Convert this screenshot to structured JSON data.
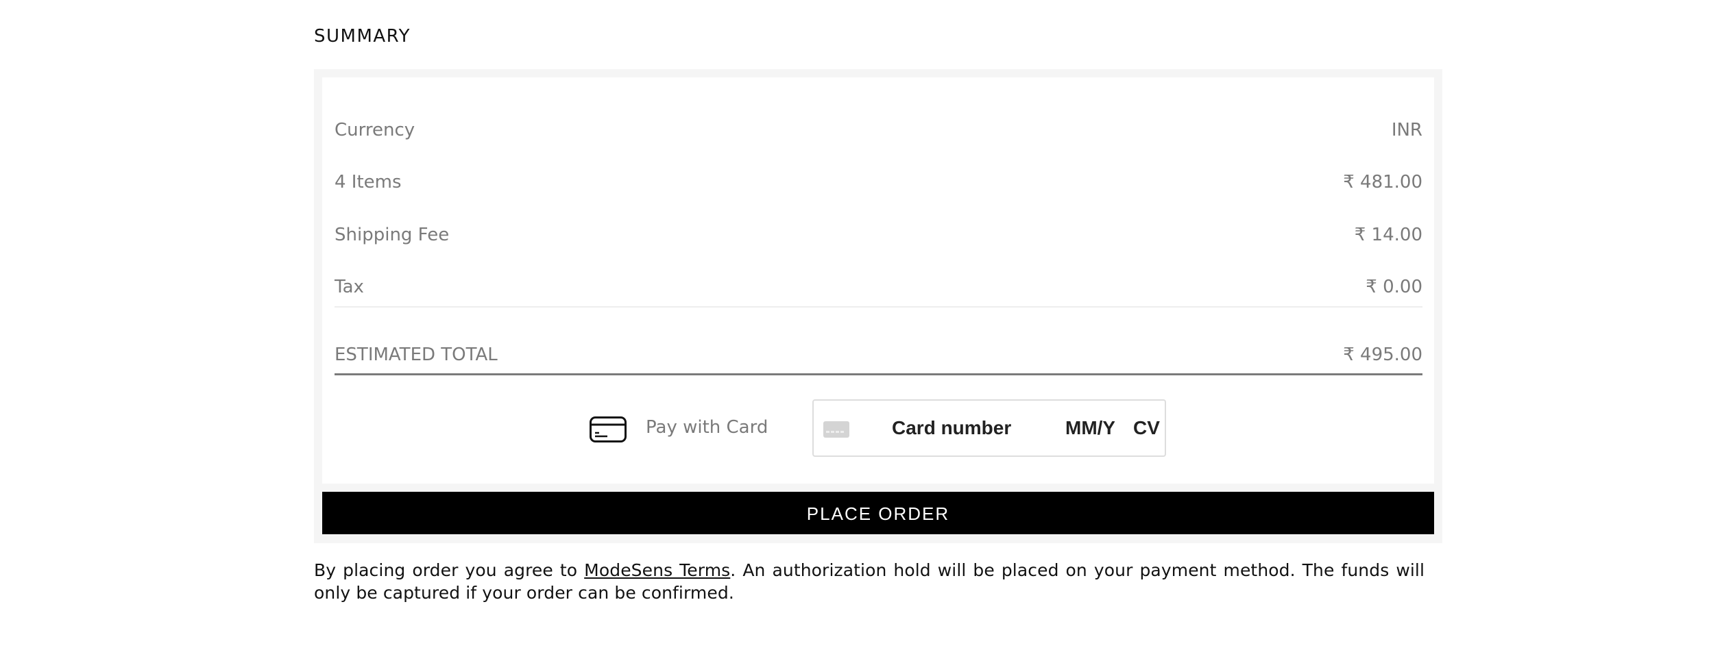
{
  "summary": {
    "title": "SUMMARY",
    "rows": [
      {
        "label": "Currency",
        "value": "INR"
      },
      {
        "label": "4 Items",
        "value": "₹ 481.00"
      },
      {
        "label": "Shipping Fee",
        "value": "₹ 14.00"
      },
      {
        "label": "Tax",
        "value": "₹ 0.00"
      }
    ],
    "total": {
      "label": "ESTIMATED TOTAL",
      "value": "₹ 495.00"
    }
  },
  "payment": {
    "pay_with_card_label": "Pay with Card",
    "card_number_placeholder": "Card number",
    "expiry_placeholder": "MM/YY",
    "cvc_placeholder": "CVC",
    "icons": {
      "pay_card": "credit-card-icon",
      "field_card": "card-brand-icon"
    }
  },
  "actions": {
    "place_order_label": "PLACE ORDER"
  },
  "terms": {
    "prefix": "By placing order you agree to ",
    "link_text": "ModeSens Terms",
    "suffix": ". An authorization hold will be placed on your payment method. The funds will only be captured if your order can be confirmed."
  },
  "colors": {
    "button_bg": "#000000",
    "button_text": "#ffffff",
    "muted_text": "#7a7a7a",
    "panel_bg": "#f5f5f5"
  }
}
